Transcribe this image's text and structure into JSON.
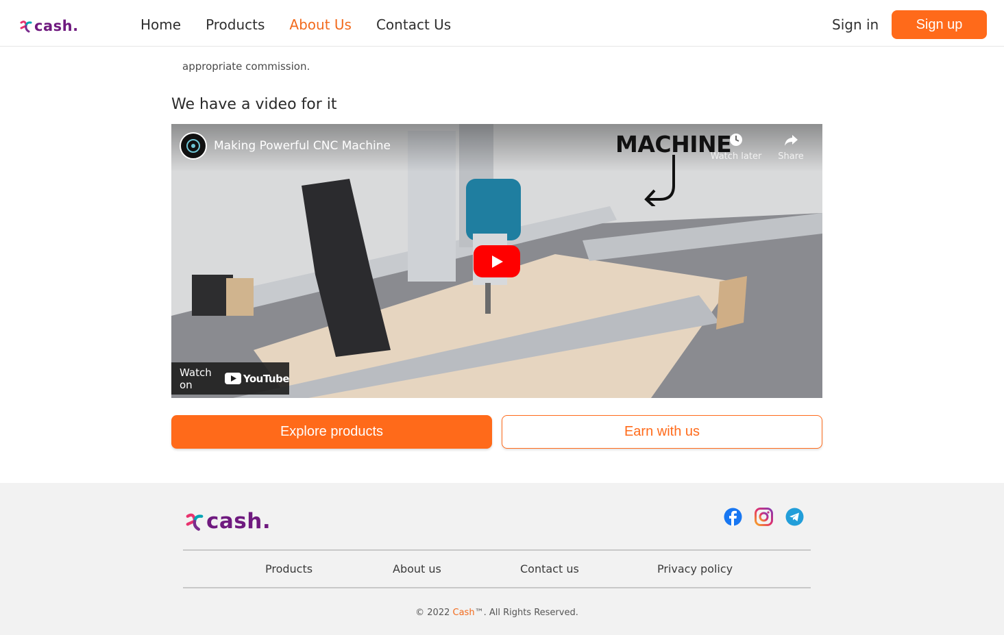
{
  "header": {
    "logo_text": "cash.",
    "nav": [
      {
        "label": "Home",
        "active": false
      },
      {
        "label": "Products",
        "active": false
      },
      {
        "label": "About Us",
        "active": true
      },
      {
        "label": "Contact Us",
        "active": false
      }
    ],
    "signin_label": "Sign in",
    "signup_label": "Sign up"
  },
  "intro": {
    "visible_tail": "appropriate commission."
  },
  "section": {
    "title": "We have a video for it"
  },
  "video": {
    "title": "Making Powerful CNC Machine",
    "overlay_text": "MACHINE",
    "watch_later_label": "Watch later",
    "share_label": "Share",
    "watch_on_label": "Watch on",
    "youtube_label": "YouTube"
  },
  "actions": {
    "explore_label": "Explore products",
    "earn_label": "Earn with us"
  },
  "footer": {
    "logo_text": "cash.",
    "links": [
      "Products",
      "About us",
      "Contact us",
      "Privacy policy"
    ],
    "copyright_prefix": "© 2022 ",
    "copyright_brand": "Cash",
    "copyright_suffix": "™. All Rights Reserved."
  },
  "colors": {
    "accent": "#ff6a1a",
    "brand_purple": "#6f1a7f",
    "youtube_red": "#ff0000"
  },
  "icons": [
    "logo-mark-icon",
    "clock-icon",
    "share-icon",
    "play-icon",
    "youtube-icon",
    "facebook-icon",
    "instagram-icon",
    "telegram-icon"
  ]
}
